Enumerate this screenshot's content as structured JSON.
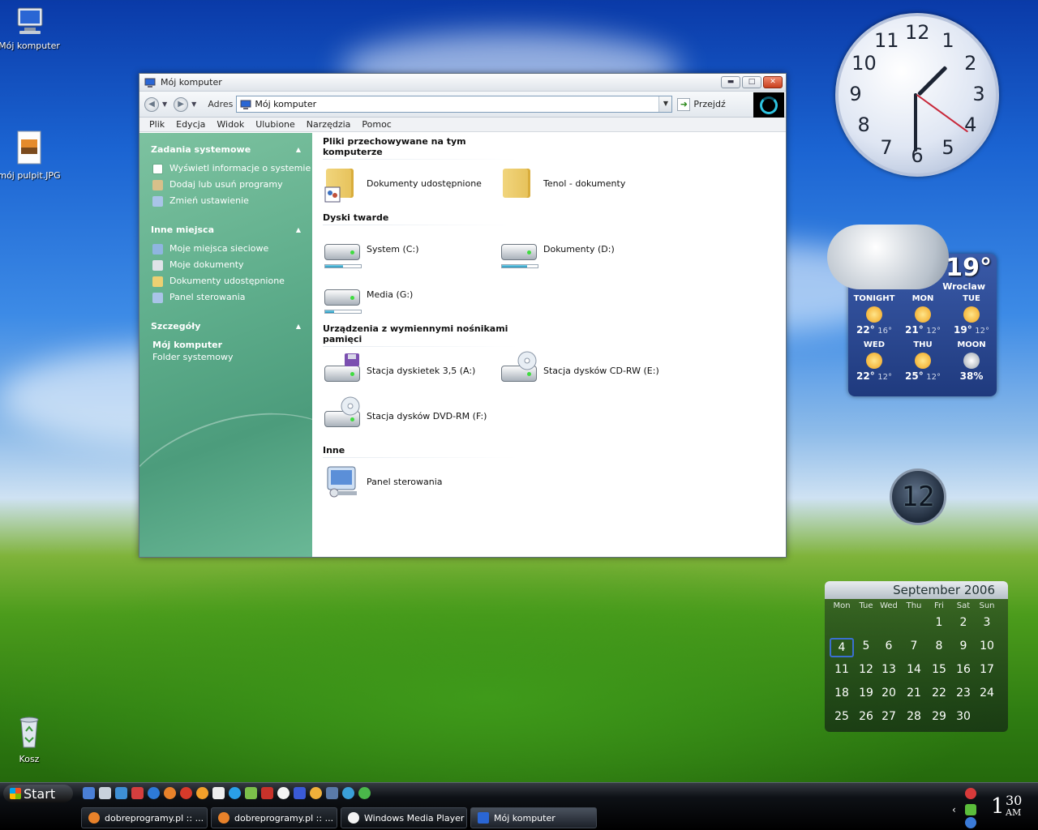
{
  "desktop": {
    "icons": [
      {
        "label": "Mój komputer"
      },
      {
        "label": "mój pulpit.JPG"
      },
      {
        "label": "Kosz"
      }
    ]
  },
  "window": {
    "title": "Mój komputer",
    "address_label": "Adres",
    "address_value": "Mój komputer",
    "go_label": "Przejdź",
    "menu": [
      "Plik",
      "Edycja",
      "Widok",
      "Ulubione",
      "Narzędzia",
      "Pomoc"
    ],
    "sidebar": {
      "system_tasks": {
        "title": "Zadania systemowe",
        "items": [
          "Wyświetl informacje o systemie",
          "Dodaj lub usuń programy",
          "Zmień ustawienie"
        ]
      },
      "other_places": {
        "title": "Inne miejsca",
        "items": [
          "Moje miejsca sieciowe",
          "Moje dokumenty",
          "Dokumenty udostępnione",
          "Panel sterowania"
        ]
      },
      "details": {
        "title": "Szczegóły",
        "name": "Mój komputer",
        "type": "Folder systemowy"
      }
    },
    "groups": {
      "stored_files": {
        "title": "Pliki przechowywane na tym komputerze",
        "items": [
          "Dokumenty udostępnione",
          "Tenol - dokumenty"
        ]
      },
      "hard_drives": {
        "title": "Dyski twarde",
        "items": [
          {
            "label": "System (C:)",
            "used": 0.5
          },
          {
            "label": "Dokumenty (D:)",
            "used": 0.7
          },
          {
            "label": "Media (G:)",
            "used": 0.25
          }
        ]
      },
      "removable": {
        "title": "Urządzenia z wymiennymi nośnikami pamięci",
        "items": [
          "Stacja dyskietek 3,5 (A:)",
          "Stacja dysków CD-RW (E:)",
          "Stacja dysków DVD-RM (F:)"
        ]
      },
      "other": {
        "title": "Inne",
        "items": [
          "Panel sterowania"
        ]
      }
    }
  },
  "clock": {
    "numbers": [
      "12",
      "1",
      "2",
      "3",
      "4",
      "5",
      "6",
      "7",
      "8",
      "9",
      "10",
      "11"
    ],
    "hour": 1,
    "minute": 30,
    "second": 21
  },
  "weather": {
    "current_temp": "19°",
    "city": "Wroclaw",
    "forecast": [
      {
        "day": "TONIGHT",
        "high": "22°",
        "low": "16°"
      },
      {
        "day": "MON",
        "high": "21°",
        "low": "12°"
      },
      {
        "day": "TUE",
        "high": "19°",
        "low": "12°"
      },
      {
        "day": "WED",
        "high": "22°",
        "low": "12°"
      },
      {
        "day": "THU",
        "high": "25°",
        "low": "12°"
      },
      {
        "day": "MOON",
        "high": "38%",
        "low": ""
      }
    ]
  },
  "digital_clock": {
    "value": "12"
  },
  "calendar": {
    "title": "September 2006",
    "weekdays": [
      "Mon",
      "Tue",
      "Wed",
      "Thu",
      "Fri",
      "Sat",
      "Sun"
    ],
    "weeks": [
      [
        "",
        "",
        "",
        "",
        "1",
        "2",
        "3"
      ],
      [
        "4",
        "5",
        "6",
        "7",
        "8",
        "9",
        "10"
      ],
      [
        "11",
        "12",
        "13",
        "14",
        "15",
        "16",
        "17"
      ],
      [
        "18",
        "19",
        "20",
        "21",
        "22",
        "23",
        "24"
      ],
      [
        "25",
        "26",
        "27",
        "28",
        "29",
        "30",
        ""
      ]
    ],
    "today": "4"
  },
  "taskbar": {
    "start_label": "Start",
    "tasks": [
      {
        "label": "dobreprogramy.pl :: ..."
      },
      {
        "label": "dobreprogramy.pl :: ..."
      },
      {
        "label": "Windows Media Player"
      },
      {
        "label": "Mój komputer"
      }
    ],
    "clock_hour": "1",
    "clock_minute": "30",
    "clock_ampm": "AM"
  },
  "colors": {
    "sidebar": "#5fae8c",
    "accent": "#3b6fd1",
    "close_button": "#c8401e"
  }
}
